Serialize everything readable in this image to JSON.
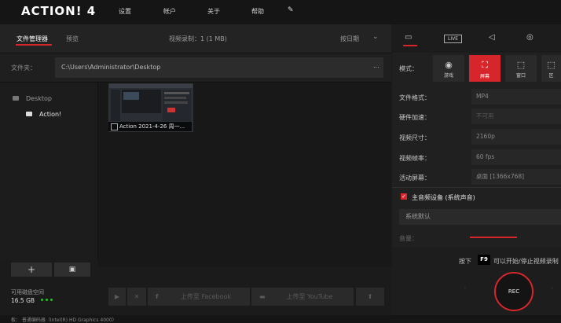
{
  "app": {
    "logo": "ACTION! 4"
  },
  "topmenu": [
    "设置",
    "帐户",
    "关于",
    "帮助"
  ],
  "left": {
    "tabs": {
      "file_manager": "文件管理器",
      "preview": "预览"
    },
    "video_count": "视频录制：1 (1 MB)",
    "sort": "按日期",
    "folder": {
      "label": "文件夹：",
      "path": "C:\\Users\\Administrator\\Desktop",
      "more": "..."
    },
    "tree": {
      "desktop": "Desktop",
      "action": "Action!"
    },
    "file": {
      "title": "Action 2021-4-26 周一..."
    },
    "disk": {
      "label": "可用磁盘空间",
      "value": "16.5 GB"
    },
    "actions": {
      "facebook": "上传至 Facebook",
      "youtube": "上传至 YouTube"
    }
  },
  "status": {
    "text": "板：   普通编码器（Intel(R) HD Graphics 4000）"
  },
  "right": {
    "mode_label": "模式：",
    "modes": [
      {
        "label": "游戏"
      },
      {
        "label": "屏幕"
      },
      {
        "label": "窗口"
      },
      {
        "label": "区"
      }
    ],
    "settings": [
      {
        "label": "文件格式：",
        "value": "MP4"
      },
      {
        "label": "硬件加速：",
        "value": "不可用"
      },
      {
        "label": "视频尺寸：",
        "value": "2160p"
      },
      {
        "label": "视频帧率：",
        "value": "60 fps"
      },
      {
        "label": "活动屏幕：",
        "value": "桌面 [1366x768]"
      }
    ],
    "audio": {
      "label": "主音频设备 (系统声音)",
      "device": "系统默认",
      "volume_label": "音量："
    },
    "hint": {
      "pre": "按下",
      "key": "F9",
      "post": "可以开始/停止视频录制"
    },
    "rec_label": "REC"
  }
}
